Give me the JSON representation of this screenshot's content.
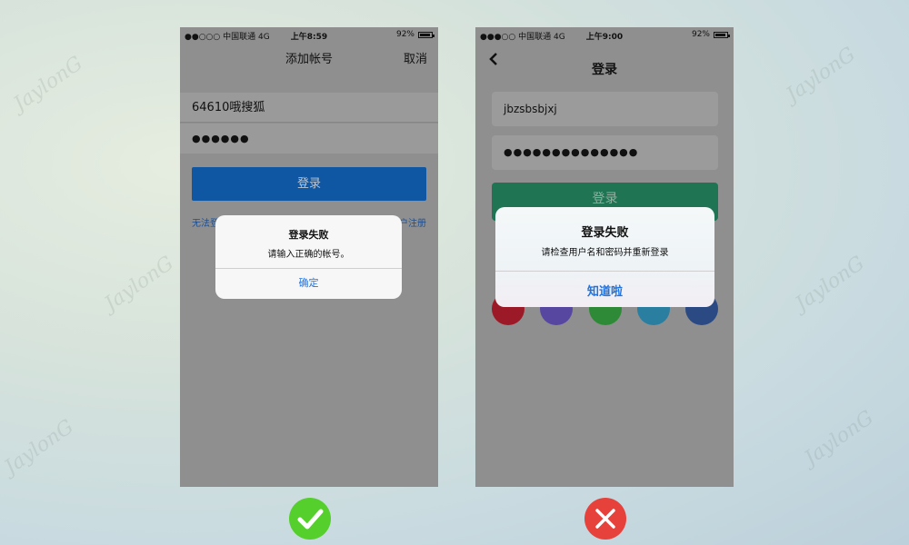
{
  "left_screen": {
    "status": {
      "carrier": "●●○○○ 中国联通  4G",
      "time": "上午8:59",
      "battery": "92%"
    },
    "nav": {
      "title": "添加帐号",
      "cancel": "取消"
    },
    "fields": {
      "account": "64610哦搜狐",
      "password": "●●●●●●"
    },
    "login_button": "登录",
    "links": {
      "left": "无法登",
      "right": "户注册"
    },
    "alert": {
      "title": "登录失败",
      "message": "请输入正确的帐号。",
      "button": "确定"
    }
  },
  "right_screen": {
    "status": {
      "carrier": "●●●○○ 中国联通  4G",
      "time": "上午9:00",
      "battery": "92%"
    },
    "nav": {
      "title": "登录"
    },
    "fields": {
      "account": "jbzsbsbjxj",
      "password": "●●●●●●●●●●●●●●"
    },
    "login_button": "登录",
    "social_icons": [
      "weibo-icon",
      "qq-icon",
      "wechat-icon",
      "alipay-icon",
      "facebook-icon"
    ],
    "alert": {
      "title": "登录失败",
      "message": "请检查用户名和密码并重新登录",
      "button": "知道啦"
    }
  },
  "badges": {
    "good": "checkmark-icon",
    "bad": "cross-icon"
  },
  "watermark": "JaylonG",
  "colors": {
    "good": "#54cf2b",
    "bad": "#e7413b",
    "alert_button": "#1e74e4",
    "left_login": "#0f56a3",
    "right_login": "#1e7453"
  }
}
